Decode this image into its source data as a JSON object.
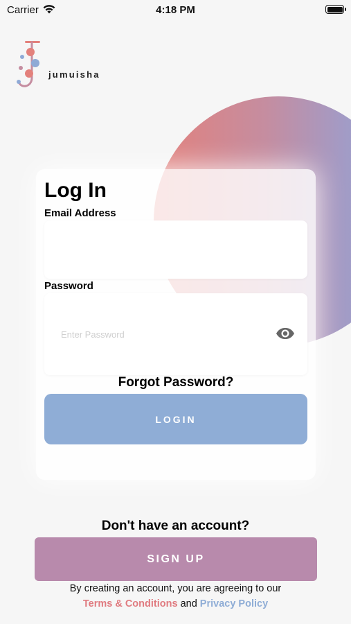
{
  "status_bar": {
    "carrier": "Carrier",
    "time": "4:18 PM"
  },
  "logo": {
    "text": "jumuisha"
  },
  "login": {
    "title": "Log In",
    "email_label": "Email Address",
    "email_value": "",
    "password_label": "Password",
    "password_placeholder": "Enter Password",
    "password_icon": "eye-icon",
    "forgot_label": "Forgot Password?",
    "login_label": "LOGIN"
  },
  "signup": {
    "prompt": "Don't have an account?",
    "button_label": "SIGN UP"
  },
  "legal": {
    "line1": "By creating an account, you are agreeing to our",
    "terms_label": "Terms & Conditions",
    "and_text": "and",
    "privacy_label": "Privacy Policy"
  },
  "colors": {
    "login_button": "#8fadd6",
    "signup_button": "#b88aac",
    "terms_link": "#e07b80",
    "privacy_link": "#8fadd6",
    "gradient_start": "#e3817c",
    "gradient_end": "#8faad6"
  }
}
